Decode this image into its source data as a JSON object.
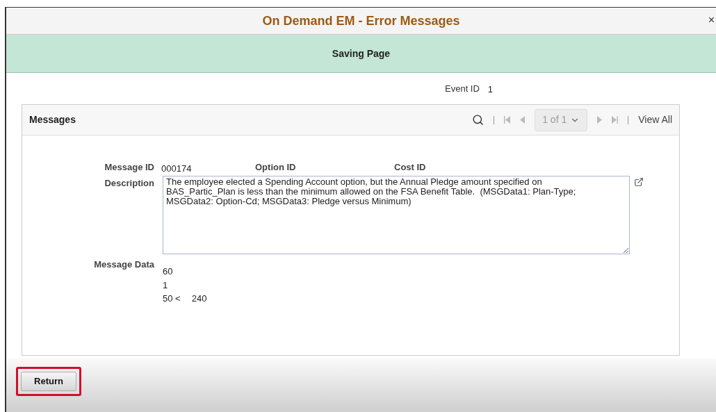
{
  "window": {
    "title": "On Demand EM - Error Messages",
    "close": "×"
  },
  "notice": {
    "text": "Saving Page"
  },
  "event": {
    "label": "Event ID",
    "value": "1"
  },
  "messages": {
    "title": "Messages",
    "pager": "1 of 1",
    "view_all": "View All",
    "fields": {
      "message_id_label": "Message ID",
      "message_id": "000174",
      "option_id_label": "Option ID",
      "cost_id_label": "Cost ID",
      "description_label": "Description",
      "description": "The employee elected a Spending Account option, but the Annual Pledge amount specified on BAS_Partic_Plan is less than the minimum allowed on the FSA Benefit Table.  (MSGData1: Plan-Type; MSGData2: Option-Cd; MSGData3: Pledge versus Minimum)",
      "message_data_label": "Message Data"
    },
    "message_data": [
      [
        "60"
      ],
      [
        "1"
      ],
      [
        "50 <",
        "240"
      ]
    ]
  },
  "return_button": {
    "label": "Return",
    "highlighted": true
  }
}
